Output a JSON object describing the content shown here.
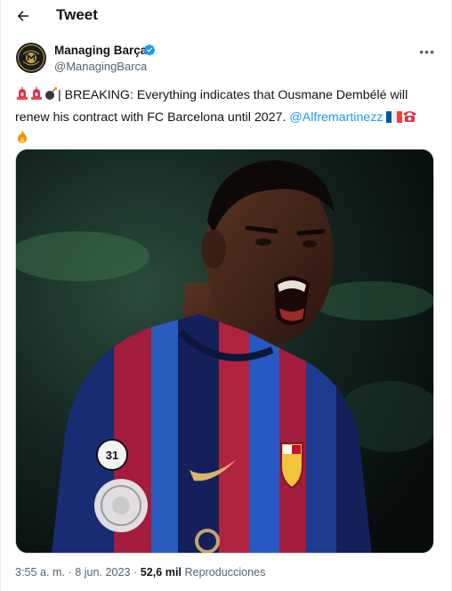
{
  "header": {
    "title": "Tweet"
  },
  "author": {
    "display_name": "Managing Barça",
    "handle": "@ManagingBarca"
  },
  "tweet": {
    "text_breaking": "| BREAKING: Everything indicates that Ousmane Dembélé will renew his contract with FC Barcelona until 2027.",
    "mention": "@Alfremartinezz",
    "emojis": [
      "siren-emoji",
      "siren-emoji",
      "bomb-emoji",
      "france-flag-emoji",
      "telephone-emoji",
      "fire-emoji"
    ]
  },
  "media": {
    "crest_number": "31"
  },
  "meta": {
    "time": "3:55 a. m.",
    "separator": "·",
    "date": "8 jun. 2023",
    "views_count": "52,6 mil",
    "views_label": "Reproducciones"
  },
  "colors": {
    "accent": "#1d9bf0",
    "text": "#0f1419",
    "secondary": "#536471"
  }
}
